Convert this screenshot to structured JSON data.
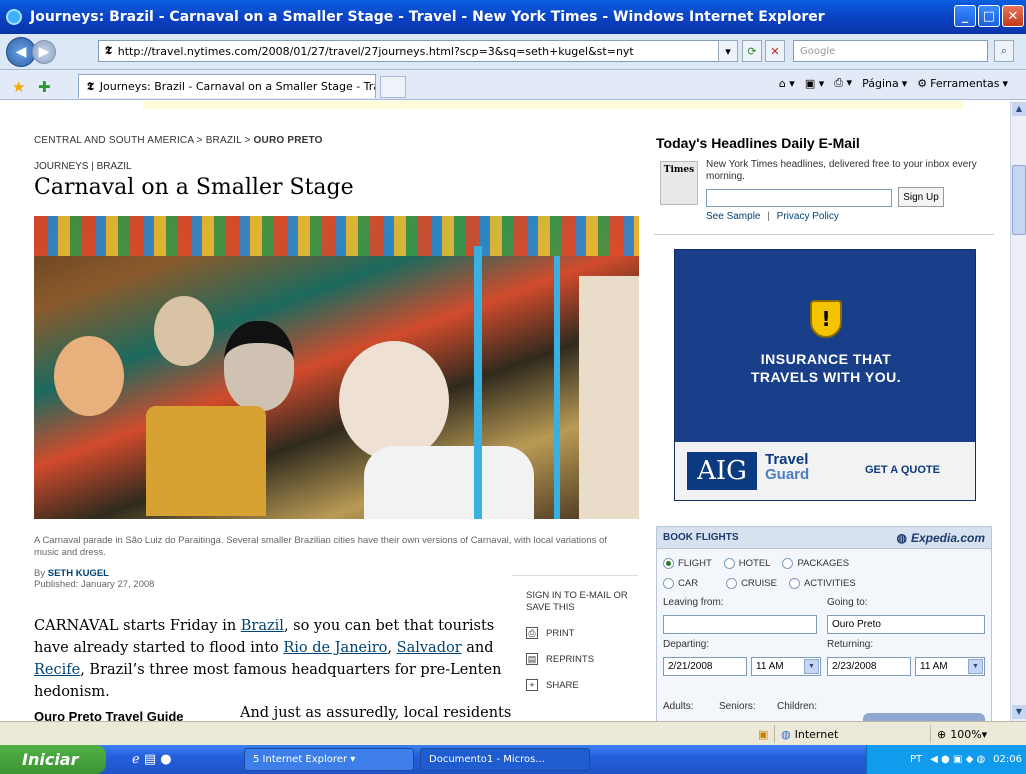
{
  "window": {
    "title": "Journeys: Brazil - Carnaval on a Smaller Stage - Travel - New York Times - Windows Internet Explorer",
    "url": "http://travel.nytimes.com/2008/01/27/travel/27journeys.html?scp=3&sq=seth+kugel&st=nyt",
    "search_placeholder": "Google",
    "tab_title": "Journeys: Brazil - Carnaval on a Smaller Stage - Trave...",
    "cmd_pagina": "Página",
    "cmd_ferramentas": "Ferramentas"
  },
  "article": {
    "breadcrumb_1": "CENTRAL AND SOUTH AMERICA",
    "breadcrumb_2": "BRAZIL",
    "breadcrumb_3": "OURO PRETO",
    "breadcrumb_sep": ">",
    "kicker": "JOURNEYS | BRAZIL",
    "headline": "Carnaval on a Smaller Stage",
    "caption": "A Carnaval parade in São Luiz do Paraitinga. Several smaller Brazilian cities have their own versions of Carnaval, with local variations of music and dress.",
    "by": "By",
    "author": "SETH KUGEL",
    "published": "Published: January 27, 2008",
    "p1_a": "CARNAVAL starts Friday in ",
    "p1_link1": "Brazil",
    "p1_b": ", so you can bet that tourists have already started to flood into ",
    "p1_link2": "Rio de Janeiro",
    "p1_c": ", ",
    "p1_link3": "Salvador",
    "p1_d": " and ",
    "p1_link4": "Recife",
    "p1_e": ", Brazil’s three most famous headquarters for pre-Lenten hedonism.",
    "subhead": "Ouro Preto Travel Guide",
    "p2": "And just as assuredly, local residents"
  },
  "tools": {
    "sign_in": "SIGN IN TO E-MAIL OR SAVE THIS",
    "print": "PRINT",
    "reprints": "REPRINTS",
    "share": "SHARE"
  },
  "email": {
    "title": "Today's Headlines Daily E-Mail",
    "icon_text": "Times",
    "desc": "New York Times headlines, delivered free to your inbox every morning.",
    "signup": "Sign Up",
    "see_sample": "See Sample",
    "sep": "|",
    "privacy": "Privacy Policy"
  },
  "ad": {
    "line1": "INSURANCE THAT",
    "line2": "TRAVELS WITH YOU.",
    "brand": "AIG",
    "travel": "Travel",
    "guard": "Guard",
    "cta": "GET A QUOTE"
  },
  "flights": {
    "header": "BOOK FLIGHTS",
    "partner": "Expedia.com",
    "opt_flight": "FLIGHT",
    "opt_hotel": "HOTEL",
    "opt_packages": "PACKAGES",
    "opt_car": "CAR",
    "opt_cruise": "CRUISE",
    "opt_activities": "ACTIVITIES",
    "leaving_label": "Leaving from:",
    "going_label": "Going to:",
    "going_value": "Ouro Preto",
    "departing_label": "Departing:",
    "returning_label": "Returning:",
    "depart_date": "2/21/2008",
    "depart_time": "11 AM",
    "return_date": "2/23/2008",
    "return_time": "11 AM",
    "adults_label": "Adults:",
    "seniors_label": "Seniors:",
    "children_label": "Children:"
  },
  "status": {
    "zone": "Internet",
    "zoom": "100%"
  },
  "taskbar": {
    "start": "Iniciar",
    "ie_group": "5 Internet Explorer",
    "doc": "Documento1 - Micros...",
    "lang": "PT",
    "time": "02:06"
  }
}
